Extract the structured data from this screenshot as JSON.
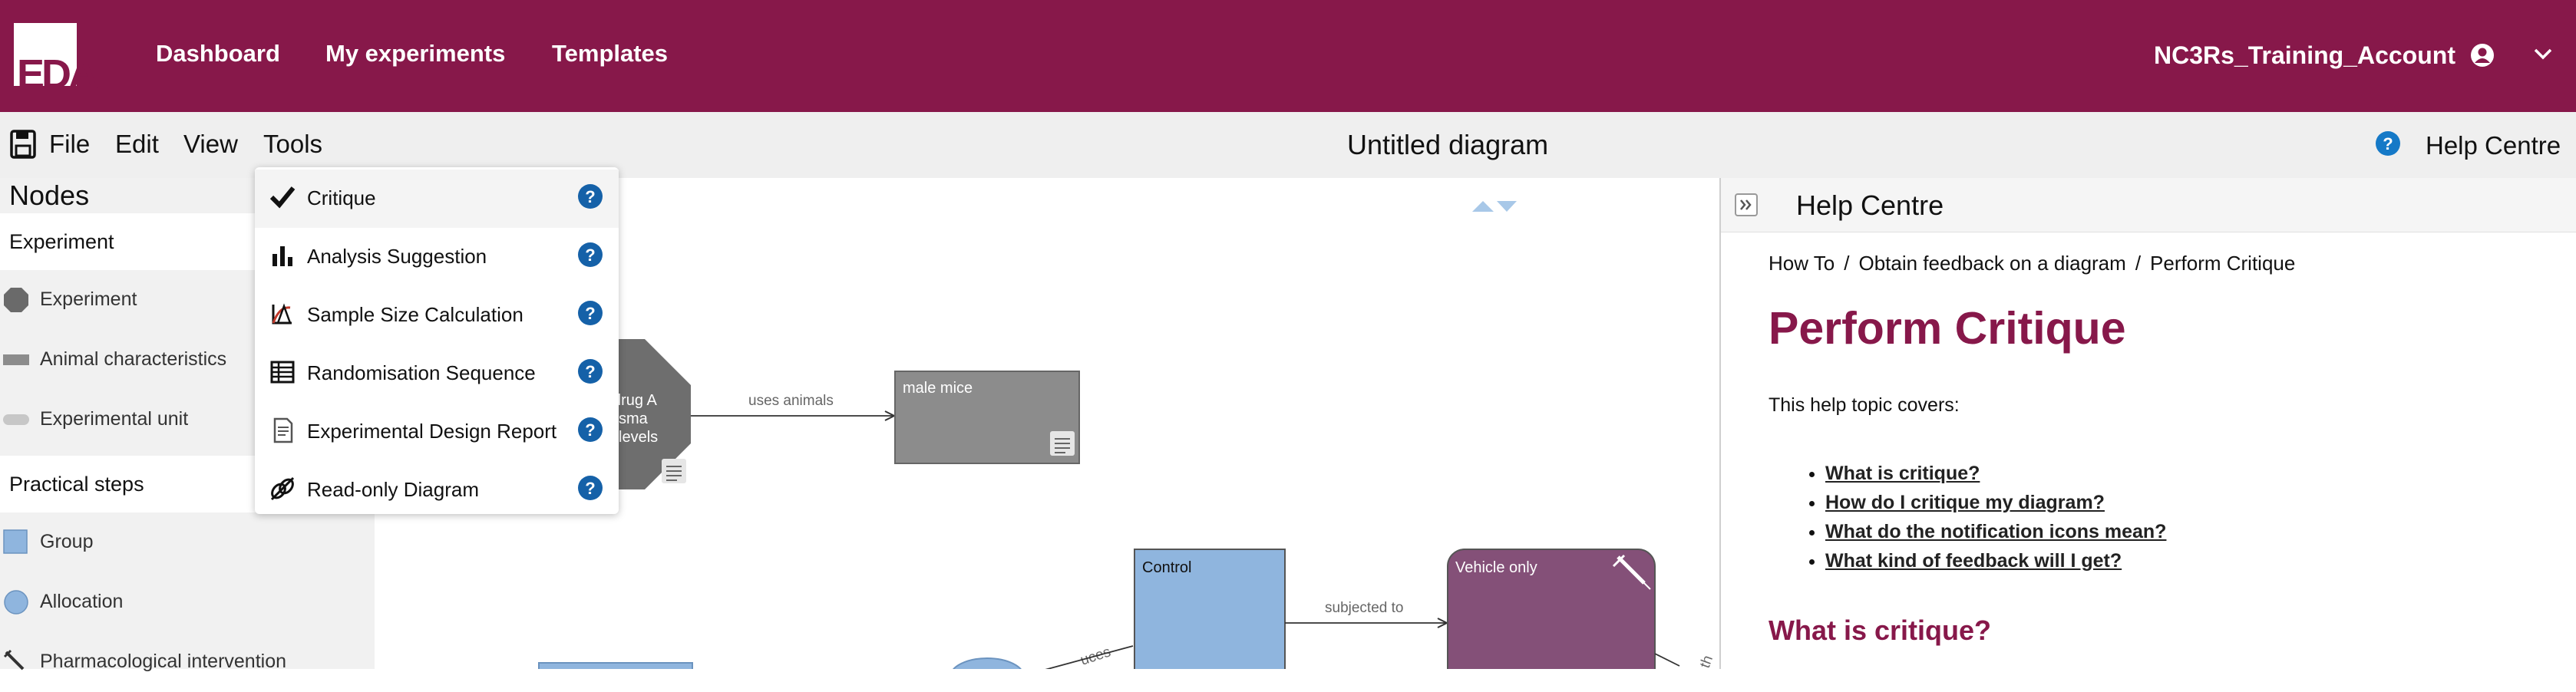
{
  "topnav": {
    "logo_text": "EDA",
    "links": [
      "Dashboard",
      "My experiments",
      "Templates"
    ],
    "account_name": "NC3Rs_Training_Account",
    "icons": {
      "account": "user-circle-icon",
      "caret": "chevron-down-icon"
    }
  },
  "menubar": {
    "items": [
      "File",
      "Edit",
      "View",
      "Tools"
    ],
    "diagram_title": "Untitled diagram",
    "help_centre_label": "Help Centre",
    "icons": {
      "save": "save-icon",
      "help": "help-question-icon"
    }
  },
  "palette": {
    "title": "Nodes",
    "sections": [
      {
        "label": "Experiment",
        "items": [
          "Experiment",
          "Animal characteristics",
          "Experimental unit"
        ]
      },
      {
        "label": "Practical steps",
        "items": [
          "Group",
          "Allocation",
          "Pharmacological intervention"
        ]
      }
    ]
  },
  "tools_menu": {
    "items": [
      {
        "label": "Critique",
        "icon": "checkmark-icon"
      },
      {
        "label": "Analysis Suggestion",
        "icon": "bar-chart-icon"
      },
      {
        "label": "Sample Size Calculation",
        "icon": "sample-size-icon"
      },
      {
        "label": "Randomisation Sequence",
        "icon": "table-icon"
      },
      {
        "label": "Experimental Design Report",
        "icon": "report-icon"
      },
      {
        "label": "Read-only Diagram",
        "icon": "unlink-icon"
      }
    ]
  },
  "canvas": {
    "nodes": {
      "experiment_lines": [
        "drug A",
        "sma",
        "levels"
      ],
      "male_mice": "male mice",
      "control": "Control",
      "vehicle_only": "Vehicle only"
    },
    "edges": {
      "uses_animals": "uses animals",
      "subjected_to": "subjected to",
      "partial_left": "uces",
      "partial_right": "th"
    }
  },
  "help_panel": {
    "header_title": "Help Centre",
    "breadcrumb": [
      "How To",
      "Obtain feedback on a diagram",
      "Perform Critique"
    ],
    "title": "Perform Critique",
    "covers_text": "This help topic covers:",
    "links": [
      "What is critique?",
      "How do I critique my diagram?",
      "What do the notification icons mean?",
      "What kind of feedback will I get?"
    ],
    "section_heading": "What is critique?"
  },
  "colors": {
    "brand": "#87184a",
    "help_blue": "#1561a8",
    "node_grey": "#8c8c8c",
    "group_blue": "#8fb5de",
    "intervention_purple": "#845078"
  }
}
